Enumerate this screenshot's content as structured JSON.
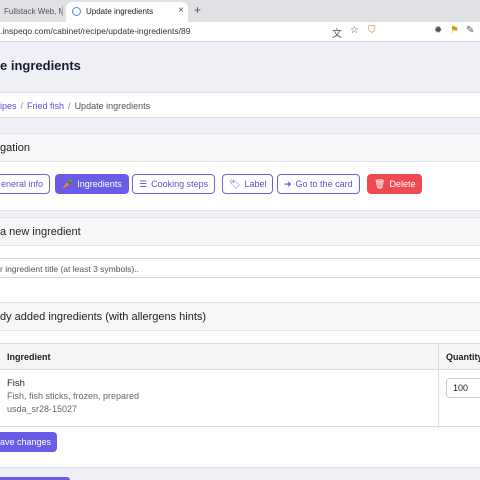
{
  "browser": {
    "tabs": [
      {
        "title": "Fullstack Web, Mo..."
      },
      {
        "title": "Update ingredients"
      }
    ],
    "url": ".inspeqo.com/cabinet/recipe/update-ingredients/89"
  },
  "page": {
    "title": "e ingredients"
  },
  "breadcrumbs": {
    "items": [
      {
        "label": "ipes"
      },
      {
        "label": "Fried fish"
      }
    ],
    "current": "Update ingredients"
  },
  "navigation": {
    "heading": "gation",
    "buttons": [
      {
        "label": "eneral info",
        "icon": "info-icon"
      },
      {
        "label": "Ingredients",
        "icon": "carrot-icon"
      },
      {
        "label": "Cooking steps",
        "icon": "list-icon"
      },
      {
        "label": "Label",
        "icon": "tag-icon"
      },
      {
        "label": "Go to the card",
        "icon": "sign-in-icon"
      },
      {
        "label": "Delete",
        "icon": "trash-icon"
      }
    ]
  },
  "new_ingredient": {
    "heading": "a new ingredient",
    "placeholder": "r ingredient title (at least 3 symbols).."
  },
  "added": {
    "heading": "dy added ingredients (with allergens hints)",
    "columns": [
      "Ingredient",
      "Quantity"
    ],
    "rows": [
      {
        "name": "Fish",
        "description": "Fish, fish sticks, frozen, prepared",
        "code": "usda_sr28-15027",
        "quantity": "100"
      }
    ],
    "save_label": "ave changes"
  },
  "colors": {
    "primary": "#6a5ce6",
    "danger": "#ef4a52",
    "link": "#5a52d6"
  }
}
